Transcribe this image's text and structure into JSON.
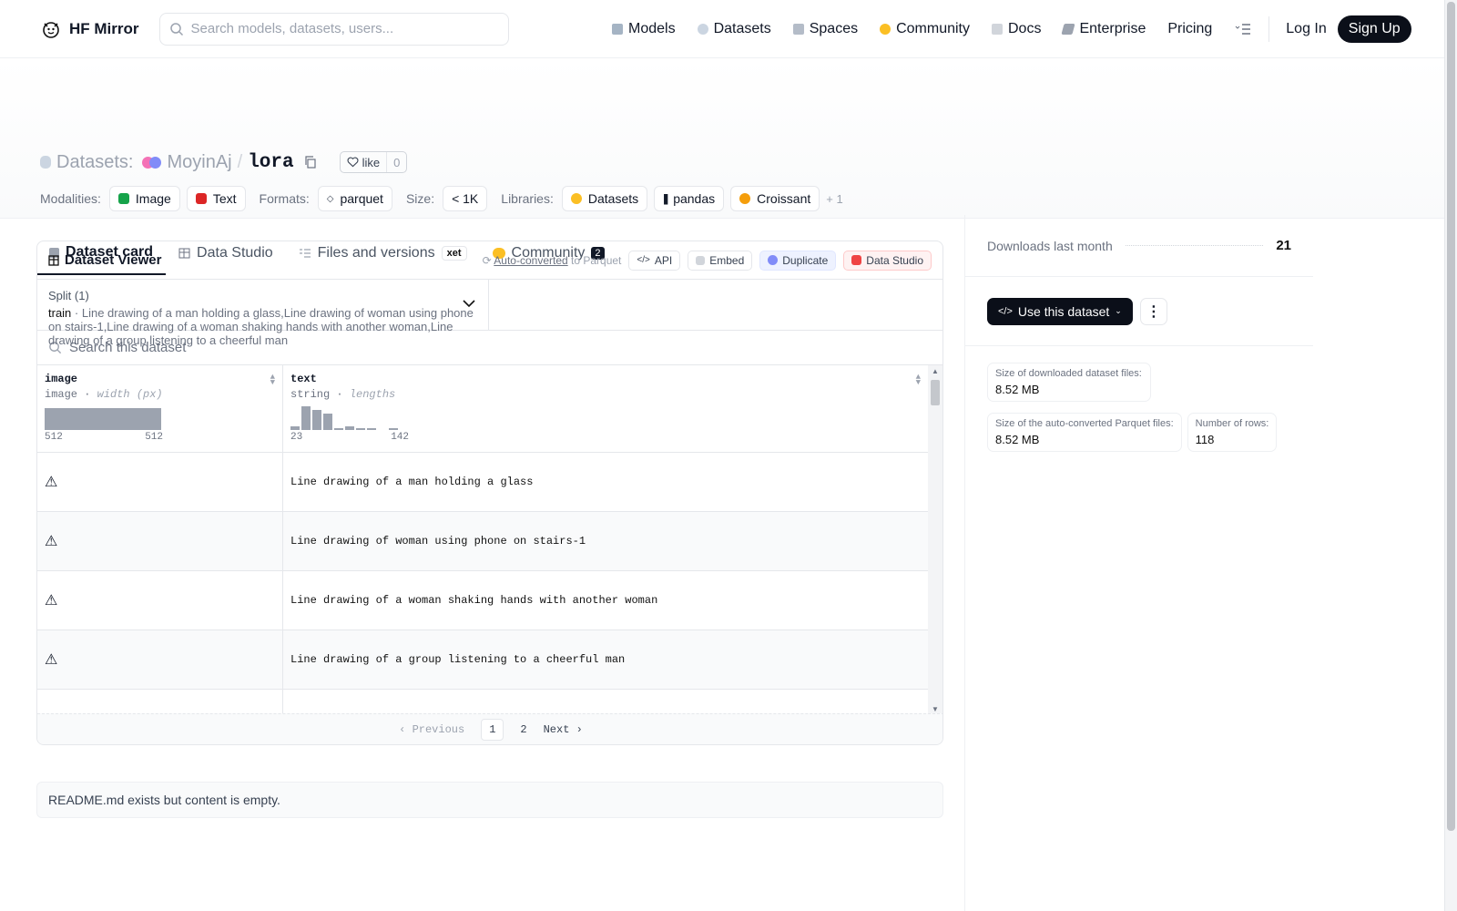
{
  "nav": {
    "brand": "HF Mirror",
    "search_placeholder": "Search models, datasets, users...",
    "links": [
      "Models",
      "Datasets",
      "Spaces",
      "Community",
      "Docs",
      "Enterprise",
      "Pricing"
    ],
    "login": "Log In",
    "signup": "Sign Up"
  },
  "header": {
    "prefix": "Datasets:",
    "owner": "MoyinAj",
    "slash": "/",
    "repo": "lora",
    "like": "like",
    "likes": "0"
  },
  "meta": {
    "modalities_label": "Modalities:",
    "modalities": [
      "Image",
      "Text"
    ],
    "formats_label": "Formats:",
    "format": "parquet",
    "size_label": "Size:",
    "size": "< 1K",
    "libraries_label": "Libraries:",
    "libraries": [
      "Datasets",
      "pandas",
      "Croissant"
    ],
    "more": "+ 1"
  },
  "tabs": {
    "card": "Dataset card",
    "studio": "Data Studio",
    "files": "Files and versions",
    "xet": "xet",
    "community": "Community",
    "community_count": "2"
  },
  "viewer": {
    "title": "Dataset Viewer",
    "auto": "Auto-converted",
    "auto_suffix": " to Parquet",
    "api": "API",
    "embed": "Embed",
    "duplicate": "Duplicate",
    "studio": "Data Studio",
    "split_label": "Split (1)",
    "split": "train",
    "rows": [
      "Line drawing of a man holding a glass",
      "Line drawing of woman using phone on stairs-1",
      "Line drawing of a woman shaking hands with another woman",
      "Line drawing of a group listening to a cheerful man"
    ],
    "search_placeholder": "Search this dataset",
    "col1": {
      "name": "image",
      "type": "image",
      "sub": "width (px)",
      "min": "512",
      "max": "512"
    },
    "col2": {
      "name": "text",
      "type": "string",
      "sub": "lengths",
      "min": "23",
      "max": "142"
    },
    "prev": "Previous",
    "page1": "1",
    "page2": "2",
    "next": "Next"
  },
  "readme": "README.md exists but content is empty.",
  "side": {
    "downloads_label": "Downloads last month",
    "downloads": "21",
    "use": "Use this dataset",
    "dl_size_label": "Size of downloaded dataset files:",
    "dl_size": "8.52 MB",
    "pq_size_label": "Size of the auto-converted Parquet files:",
    "pq_size": "8.52 MB",
    "rows_label": "Number of rows:",
    "rows": "118"
  }
}
